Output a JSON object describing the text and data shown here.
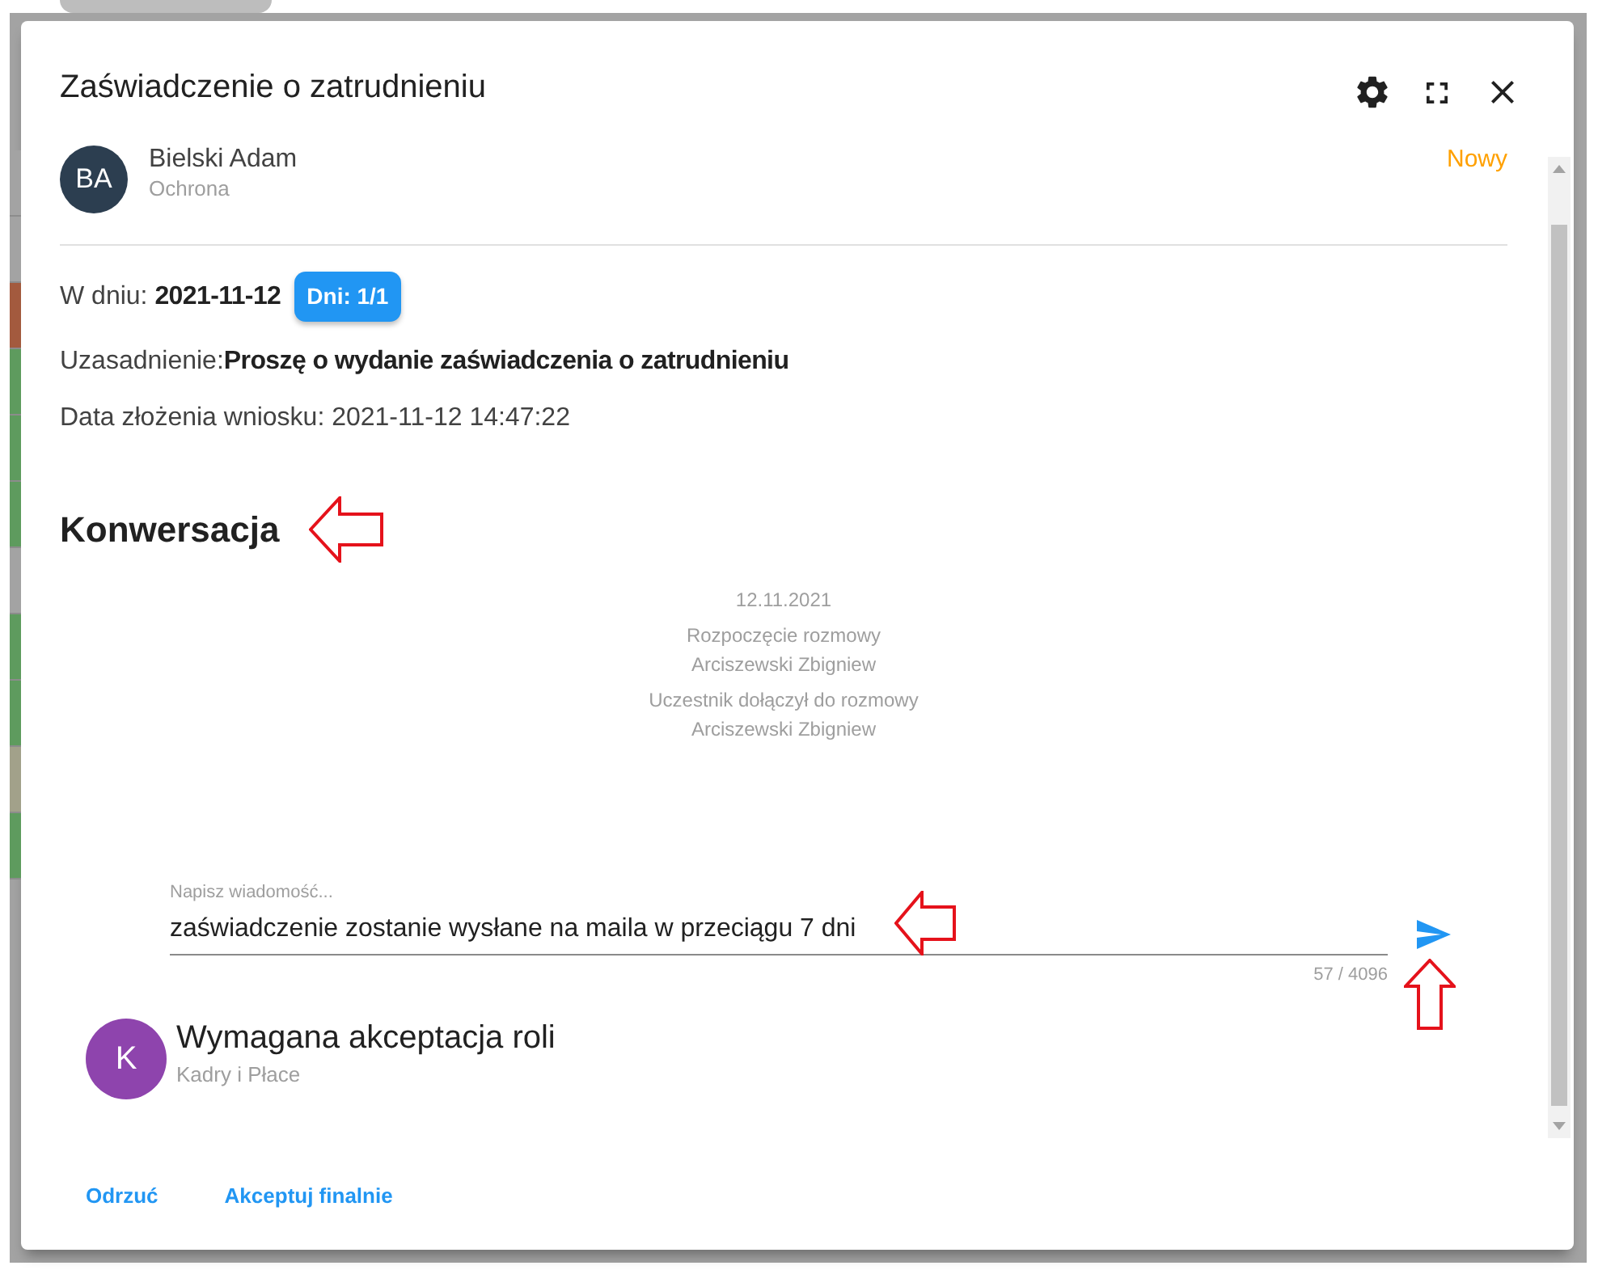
{
  "backdrop": {
    "rows": [
      {
        "color": "#a3a3a3"
      },
      {
        "color": "#a3a3a3"
      },
      {
        "color": "#a35a3e"
      },
      {
        "color": "#5e9b5e"
      },
      {
        "color": "#5e9b5e"
      },
      {
        "color": "#5e9b5e"
      },
      {
        "color": "#a3a3a3"
      },
      {
        "color": "#5e9b5e"
      },
      {
        "color": "#5e9b5e"
      },
      {
        "color": "#a2a18a"
      },
      {
        "color": "#5e9b5e"
      }
    ]
  },
  "dialog": {
    "title": "Zaświadczenie o zatrudnieniu"
  },
  "employee": {
    "initials": "BA",
    "name": "Bielski Adam",
    "department": "Ochrona",
    "status": "Nowy"
  },
  "details": {
    "date": "W dniu: **2021-11-12**",
    "days_chip": "Dni: 1/1",
    "justification": "Uzasadnienie:**Proszę o wydanie zaświadczenia o zatrudnieniu**",
    "submitted": "Data złożenia wniosku: 2021-11-12 14:47:22"
  },
  "conversation": {
    "title": "Konwersacja",
    "date": "12.11.2021",
    "events": [
      {
        "text": "Rozpoczęcie rozmowy",
        "author": "Arciszewski Zbigniew"
      },
      {
        "text": "Uczestnik dołączył do rozmowy",
        "author": "Arciszewski Zbigniew"
      }
    ]
  },
  "message_input": {
    "label": "Napisz wiadomość...",
    "value": "zaświadczenie zostanie wysłane na maila w przeciągu 7 dni",
    "counter": "57 / 4096"
  },
  "approval": {
    "initials": "K",
    "title": "Wymagana akceptacja roli",
    "role": "Kadry i Płace"
  },
  "actions": [
    "Odrzuć",
    "Akceptuj finalnie"
  ]
}
